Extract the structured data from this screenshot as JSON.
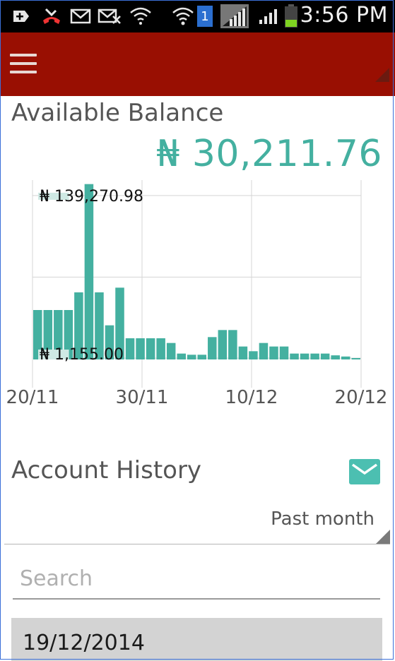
{
  "status_bar": {
    "time": "3:56 PM",
    "sim_badge": "1",
    "icons": [
      "add-box-icon",
      "missed-call-icon",
      "mail-icon",
      "mail-error-icon",
      "wifi-question-icon",
      "wifi-icon",
      "sim-badge-icon",
      "signal-icon",
      "signal-small-icon",
      "battery-icon"
    ]
  },
  "action_bar": {
    "menu_icon": "hamburger-menu-icon"
  },
  "balance": {
    "label": "Available Balance",
    "value": "₦ 30,211.76"
  },
  "chart_data": {
    "type": "bar",
    "color": "#44b0a0",
    "highlight_color": "#cfe9e4",
    "annotations": [
      "₦ 139,270.98",
      "₦ 1,155.00"
    ],
    "x_tick_labels": [
      "20/11",
      "30/11",
      "10/12",
      "20/12"
    ],
    "y_max": 150000,
    "values": [
      42000,
      42000,
      42000,
      42000,
      57000,
      149000,
      57000,
      29000,
      61000,
      18000,
      18000,
      18000,
      18000,
      14000,
      5000,
      4000,
      4000,
      19000,
      25000,
      25000,
      11000,
      7000,
      14000,
      11000,
      11000,
      5000,
      5000,
      5000,
      5000,
      3500,
      2500,
      1155
    ],
    "gridlines_y": [
      139270.98,
      70000,
      1155
    ],
    "gridlines_x_days": [
      0,
      10,
      20,
      30
    ]
  },
  "history": {
    "label": "Account History",
    "mail_icon": "envelope-icon",
    "period": "Past month",
    "search_placeholder": "Search",
    "first_date": "19/12/2014"
  }
}
